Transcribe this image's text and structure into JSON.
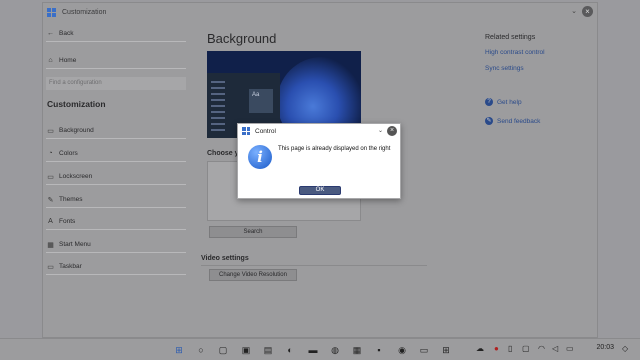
{
  "window": {
    "title": "Customization"
  },
  "sidebar": {
    "back": "Back",
    "home": "Home",
    "search_placeholder": "Find a configuration",
    "section": "Customization",
    "items": [
      {
        "label": "Background",
        "icon": "image-icon"
      },
      {
        "label": "Colors",
        "icon": "palette-icon"
      },
      {
        "label": "Lockscreen",
        "icon": "lockscreen-icon"
      },
      {
        "label": "Themes",
        "icon": "themes-icon"
      },
      {
        "label": "Fonts",
        "icon": "fonts-icon"
      },
      {
        "label": "Start Menu",
        "icon": "start-menu-icon"
      },
      {
        "label": "Taskbar",
        "icon": "taskbar-icon"
      }
    ]
  },
  "main": {
    "title": "Background",
    "preview_tile": "Aa",
    "choose_label": "Choose yo",
    "search_button": "Search",
    "video_title": "Video settings",
    "video_button": "Change Video Resolution"
  },
  "related": {
    "title": "Related settings",
    "links": [
      "High contrast control",
      "Sync settings"
    ],
    "help": "Get help",
    "feedback": "Send feedback"
  },
  "dialog": {
    "title": "Control",
    "message": "This page is already displayed on the right",
    "ok": "OK"
  },
  "taskbar": {
    "time": "20:03"
  },
  "colors": {
    "accent": "#3a6fc8",
    "link": "#2a4a8a",
    "dialog_button": "#4a5a80"
  }
}
